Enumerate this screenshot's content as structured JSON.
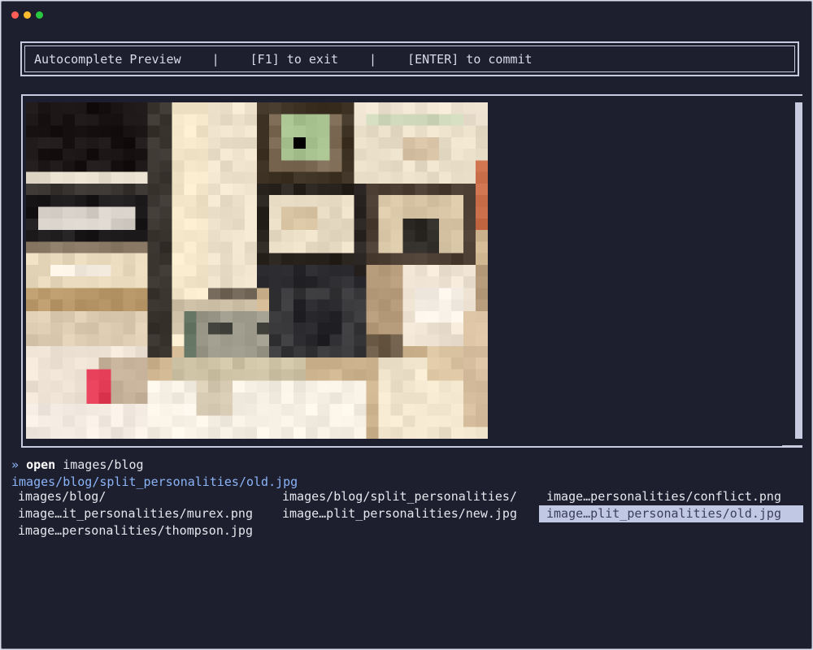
{
  "window": {
    "controls": [
      "close",
      "minimize",
      "maximize"
    ]
  },
  "header": {
    "title": "Autocomplete Preview",
    "separator": "|",
    "exit_hint": "[F1] to exit",
    "commit_hint": "[ENTER] to commit"
  },
  "preview": {
    "content": "pixelated-photo-preview"
  },
  "prompt": {
    "symbol": "»",
    "command": "open",
    "argument": "images/blog"
  },
  "completion": "images/blog/split_personalities/old.jpg",
  "suggestions": [
    {
      "label": "images/blog/",
      "selected": false
    },
    {
      "label": "images/blog/split_personalities/",
      "selected": false
    },
    {
      "label": "image…personalities/conflict.png",
      "selected": false
    },
    {
      "label": "image…it_personalities/murex.png",
      "selected": false
    },
    {
      "label": "image…plit_personalities/new.jpg",
      "selected": false
    },
    {
      "label": "image…plit_personalities/old.jpg",
      "selected": true
    },
    {
      "label": "image…personalities/thompson.jpg",
      "selected": false
    }
  ],
  "colors": {
    "background": "#1e1f2e",
    "border": "#c8cbe0",
    "accent": "#8ab4f8",
    "selection": "#c1c8e4"
  }
}
